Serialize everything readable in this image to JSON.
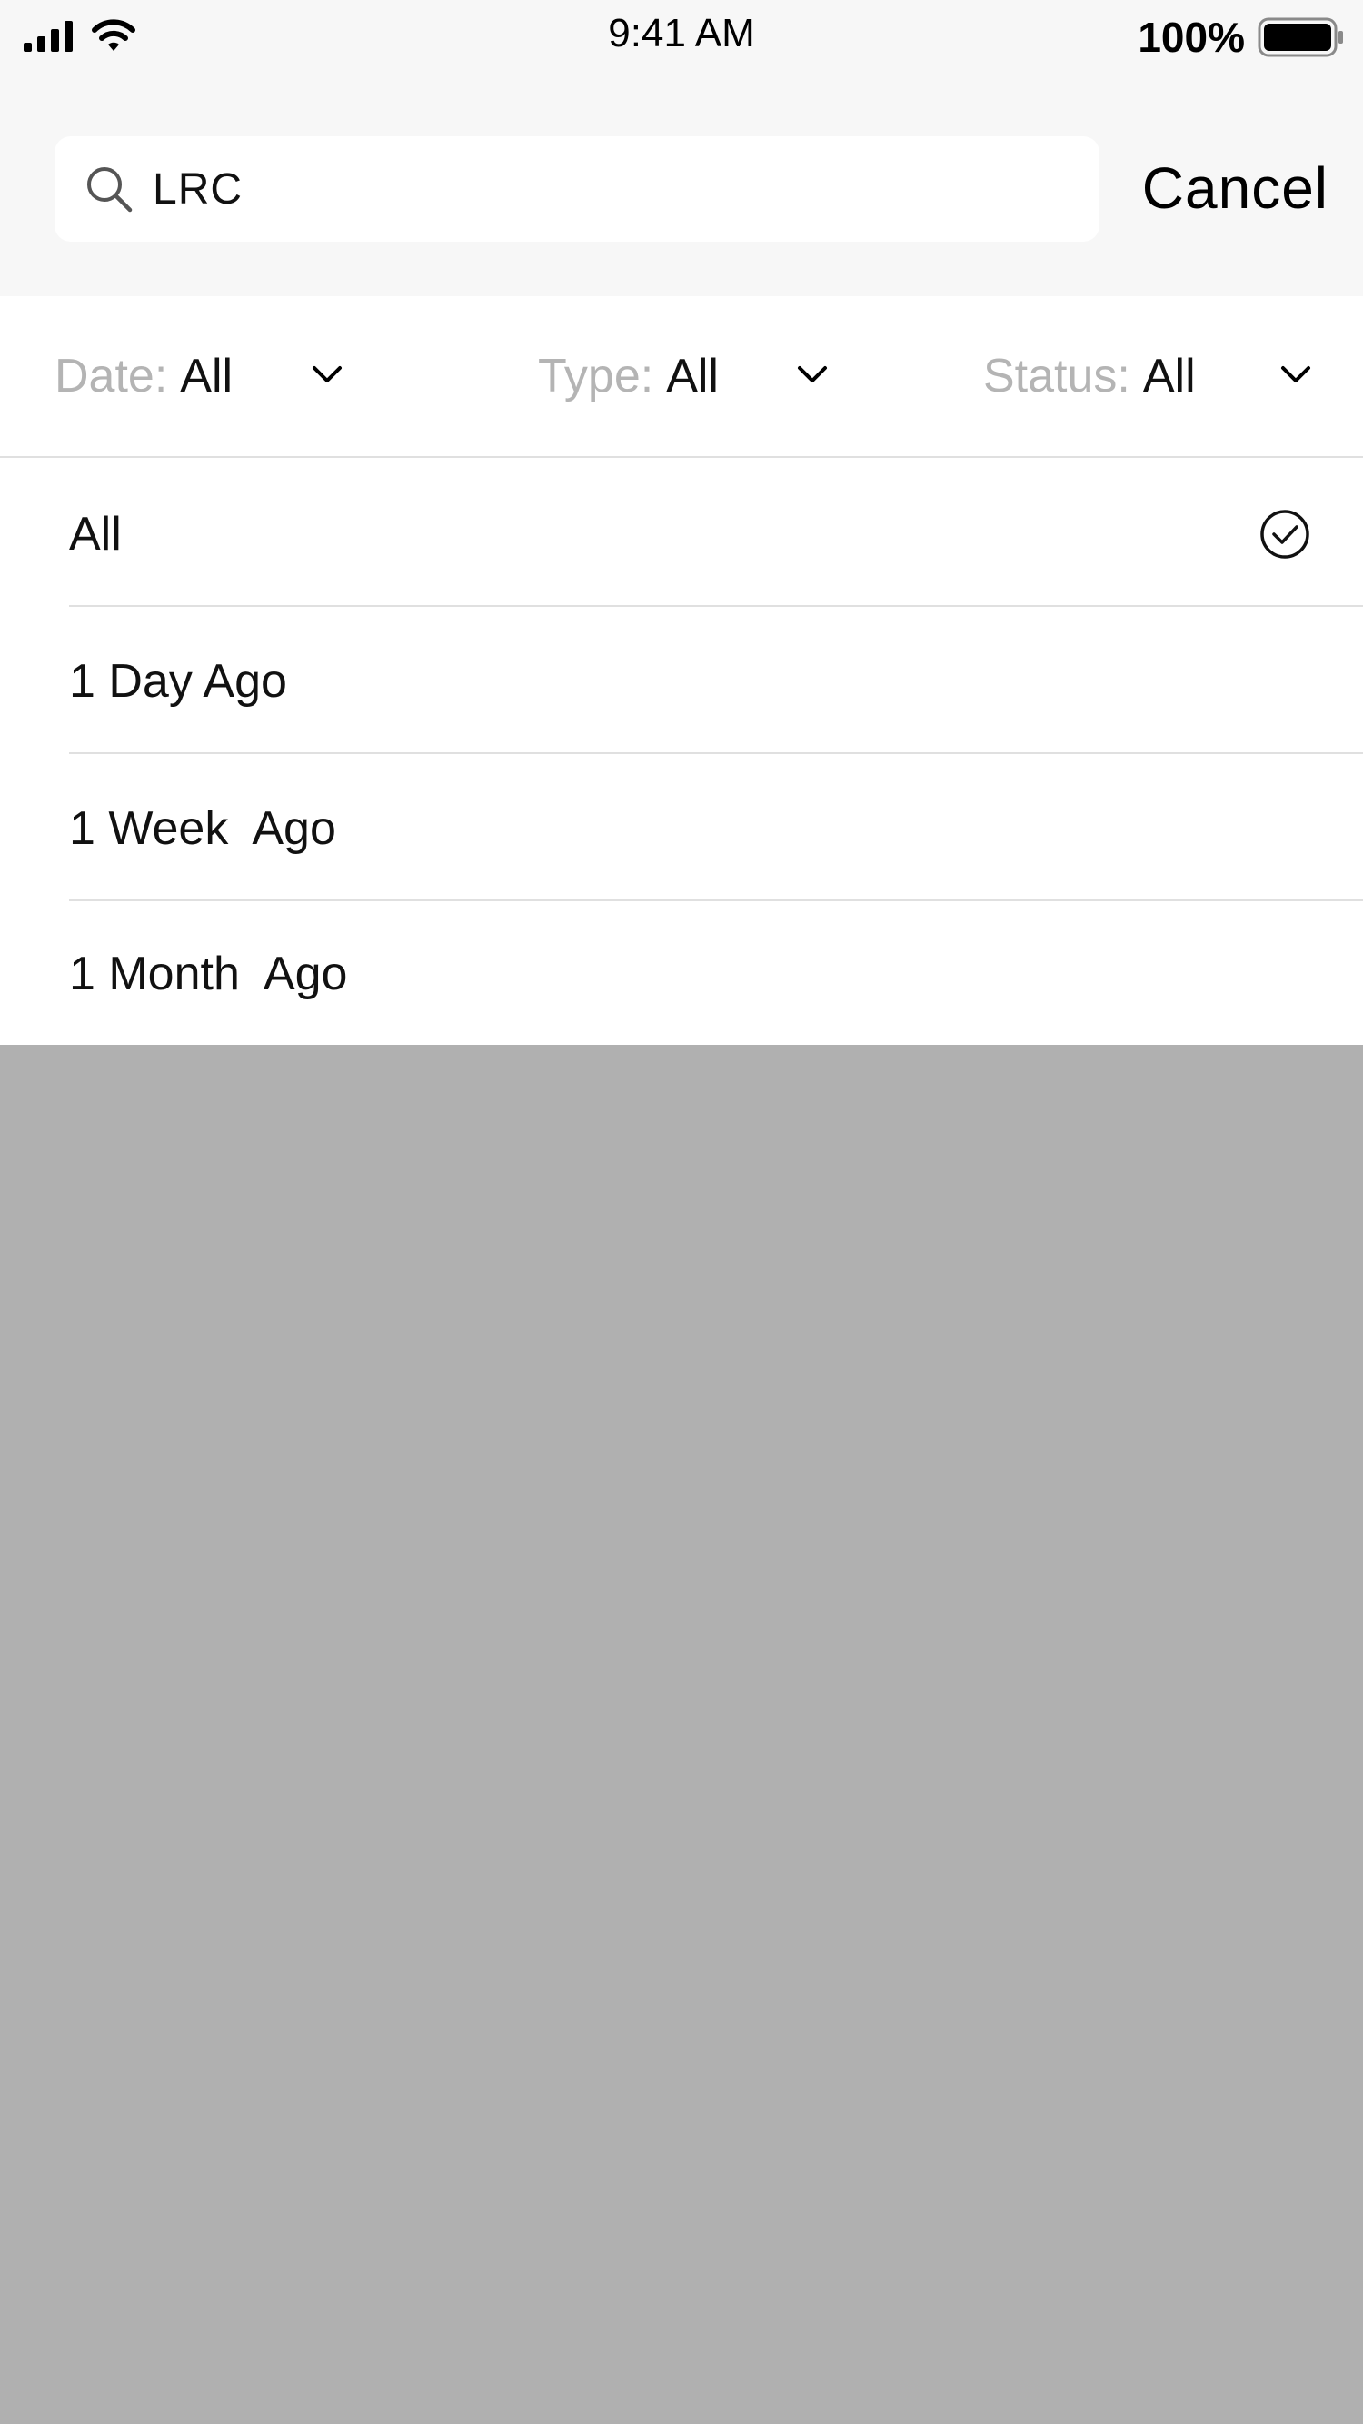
{
  "status_bar": {
    "time": "9:41 AM",
    "battery": "100%",
    "icons": [
      "cellular-signal-icon",
      "wifi-icon",
      "battery-icon"
    ]
  },
  "search": {
    "query": "LRC",
    "cancel_label": "Cancel",
    "icon": "search-icon"
  },
  "filters": [
    {
      "label": "Date:",
      "value": "All",
      "icon": "chevron-down-icon"
    },
    {
      "label": "Type:",
      "value": "All",
      "icon": "chevron-down-icon"
    },
    {
      "label": "Status:",
      "value": "All",
      "icon": "chevron-down-icon"
    }
  ],
  "date_options": {
    "items": [
      {
        "label": "All",
        "selected": true
      },
      {
        "label": "1 Day Ago",
        "selected": false
      },
      {
        "label": "1 Week  Ago",
        "selected": false
      },
      {
        "label": "1 Month  Ago",
        "selected": false
      }
    ],
    "selected_icon": "check-circle-icon"
  },
  "colors": {
    "header_bg": "#f7f7f7",
    "overlay": "#b0b0b0",
    "muted_label": "#b4b4b4",
    "divider": "#e0e0e0"
  }
}
